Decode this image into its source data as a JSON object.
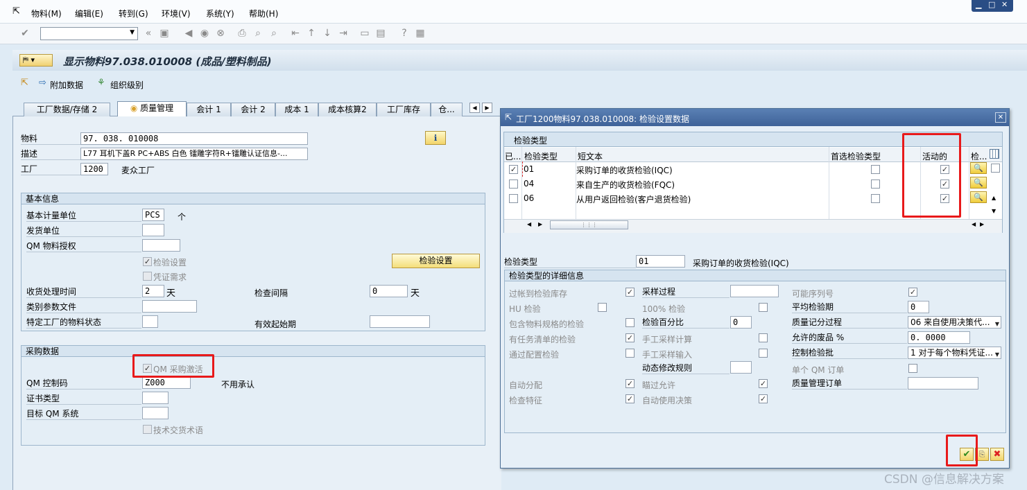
{
  "menu": [
    "物料(M)",
    "编辑(E)",
    "转到(G)",
    "环境(V)",
    "系统(Y)",
    "帮助(H)"
  ],
  "title": "显示物料97.038.010008 (成品/塑料制品)",
  "subtoolbar": {
    "add_data": "附加数据",
    "org_levels": "组织级别"
  },
  "tabs": [
    "工厂数据/存储 2",
    "质量管理",
    "会计 1",
    "会计 2",
    "成本 1",
    "成本核算2",
    "工厂库存",
    "仓..."
  ],
  "header": {
    "material_label": "物料",
    "material_value": "97. 038. 010008",
    "desc_label": "描述",
    "desc_value": "L77 耳机下盖R  PC+ABS 白色  镭雕字符R+镭雕认证信息-...",
    "plant_label": "工厂",
    "plant_value": "1200",
    "plant_name": "麦众工厂"
  },
  "basic": {
    "title": "基本信息",
    "base_uom_label": "基本计量单位",
    "base_uom_value": "PCS",
    "base_uom_text": "个",
    "issue_unit_label": "发货单位",
    "qm_auth_label": "QM 物料授权",
    "insp_setup_label": "检验设置",
    "cert_req_label": "凭证需求",
    "insp_setup_button": "检验设置",
    "gr_time_label": "收货处理时间",
    "gr_time_value": "2",
    "gr_time_unit": "天",
    "interval_label": "检查间隔",
    "interval_value": "0",
    "interval_unit": "天",
    "class_file_label": "类别参数文件",
    "plant_status_label": "特定工厂的物料状态",
    "valid_from_label": "有效起始期"
  },
  "purchasing": {
    "title": "采购数据",
    "qm_active_label": "QM 采购激活",
    "control_key_label": "QM 控制码",
    "control_key_value": "Z000",
    "control_key_text": "不用承认",
    "cert_type_label": "证书类型",
    "target_qm_label": "目标 QM 系统",
    "tech_terms_label": "技术交货术语"
  },
  "dialog": {
    "title": "工厂1200物料97.038.010008: 检验设置数据",
    "section_label": "检验类型",
    "columns": [
      "已...",
      "检验类型",
      "短文本",
      "首选检验类型",
      "活动的",
      "检..."
    ],
    "rows": [
      {
        "type": "01",
        "text": "采购订单的收货检验(IQC)",
        "selected": "✓",
        "preferred": "",
        "active": "✓"
      },
      {
        "type": "04",
        "text": "来自生产的收货检验(FQC)",
        "selected": "",
        "preferred": "",
        "active": "✓"
      },
      {
        "type": "06",
        "text": "从用户返回检验(客户退货检验)",
        "selected": "",
        "preferred": "",
        "active": "✓"
      }
    ],
    "insp_type_label": "检验类型",
    "insp_type_value": "01",
    "insp_type_text": "采购订单的收货检验(IQC)",
    "detail_title": "检验类型的详细信息",
    "col1": [
      {
        "label": "过帐到检验库存",
        "checked": "✓"
      },
      {
        "label": "HU 检验",
        "checked": ""
      },
      {
        "label": "包含物料规格的检验",
        "checked": ""
      },
      {
        "label": "有任务清单的检验",
        "checked": "✓"
      },
      {
        "label": "通过配置检验",
        "checked": ""
      },
      {
        "label": "自动分配",
        "checked": "✓"
      },
      {
        "label": "检查特征",
        "checked": "✓"
      }
    ],
    "col2": {
      "sampling_proc": "采样过程",
      "pct100": "100% 检验",
      "pct_label": "检验百分比",
      "pct_value": "0",
      "manual_calc": "手工采样计算",
      "manual_input": "手工采样输入",
      "dyn_rule": "动态修改规则",
      "skips": "瞄过允许",
      "skips_checked": "✓",
      "auto_ud": "自动使用决策",
      "auto_ud_checked": "✓"
    },
    "col3": {
      "serial": "可能序列号",
      "serial_checked": "✓",
      "avg_dur": "平均检验期",
      "avg_dur_value": "0",
      "qscore": "质量记分过程",
      "qscore_value": "06 来自使用决策代...",
      "scrap": "允许的废品 %",
      "scrap_value": "0. 0000",
      "lot_ctrl": "控制检验批",
      "lot_ctrl_value": "1 对于每个物料凭证...",
      "single_qm": "单个 QM 订单",
      "qm_order": "质量管理订单"
    }
  },
  "watermark": "CSDN @信息解决方案"
}
